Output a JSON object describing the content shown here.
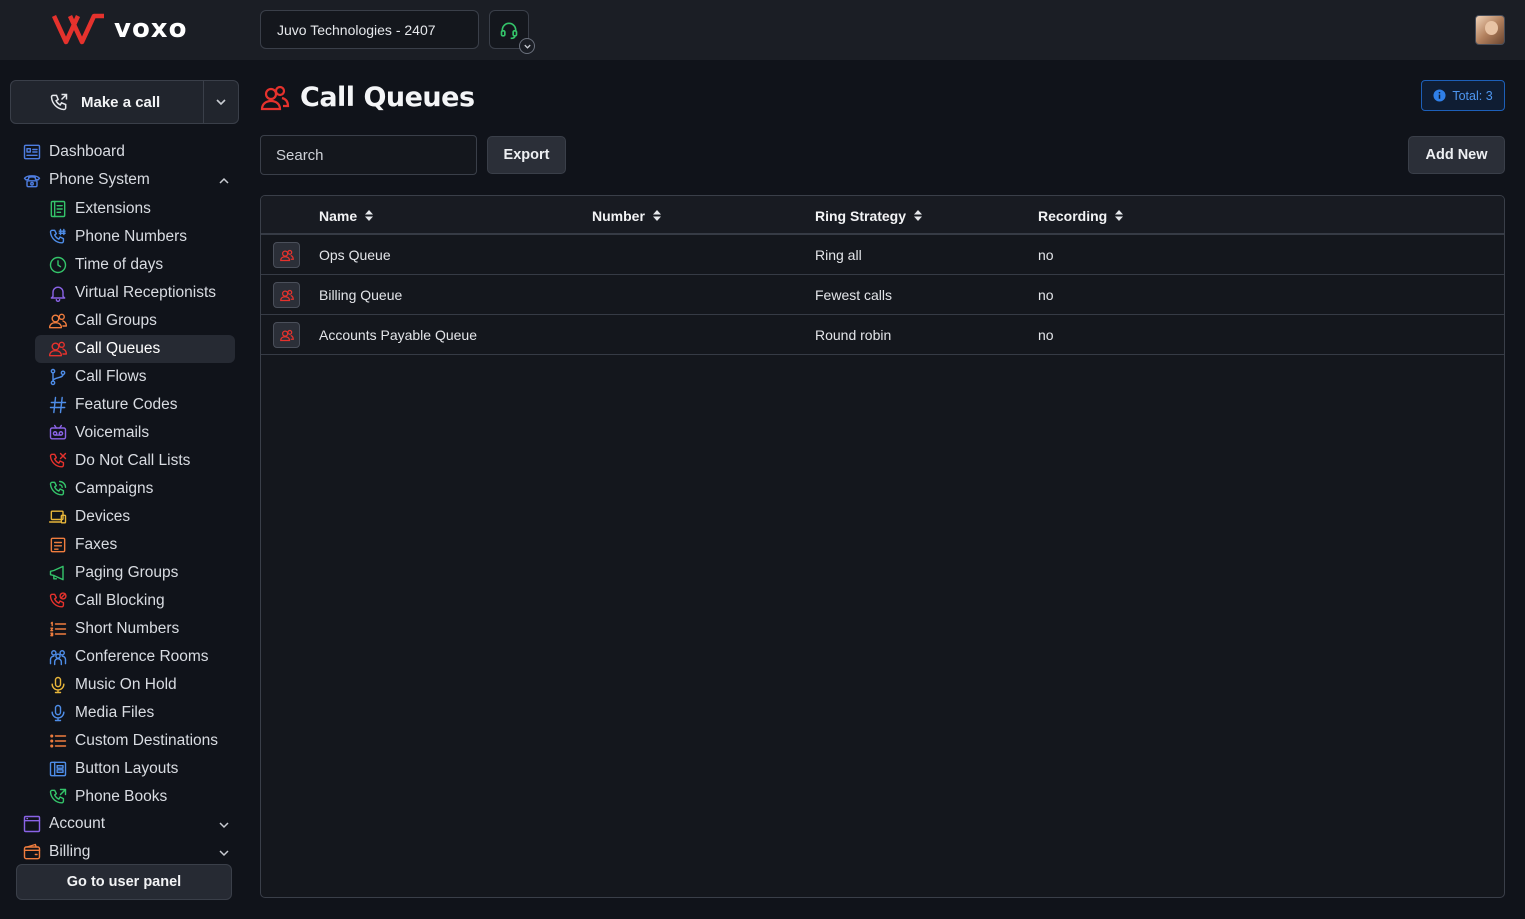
{
  "brand": {
    "name": "voxo",
    "accent": "#e5322d"
  },
  "header": {
    "tenant": "Juvo Technologies - 2407",
    "headset_icon": "headset-icon",
    "avatar": "user-avatar"
  },
  "sidebar": {
    "make_call": "Make a call",
    "items": [
      {
        "label": "Dashboard",
        "icon": "dashboard-icon",
        "color": "#4e7de0",
        "level": 0
      },
      {
        "label": "Phone System",
        "icon": "phone-system-icon",
        "color": "#4e7de0",
        "level": 0,
        "expanded": true
      },
      {
        "label": "Extensions",
        "icon": "extensions-icon",
        "color": "#34c46a",
        "level": 1
      },
      {
        "label": "Phone Numbers",
        "icon": "phone-numbers-icon",
        "color": "#4e8de8",
        "level": 1
      },
      {
        "label": "Time of days",
        "icon": "clock-icon",
        "color": "#34c46a",
        "level": 1
      },
      {
        "label": "Virtual Receptionists",
        "icon": "bell-icon",
        "color": "#8a63e6",
        "level": 1
      },
      {
        "label": "Call Groups",
        "icon": "call-groups-icon",
        "color": "#f07d3e",
        "level": 1
      },
      {
        "label": "Call Queues",
        "icon": "call-queues-icon",
        "color": "#e5322d",
        "level": 1,
        "active": true
      },
      {
        "label": "Call Flows",
        "icon": "branch-icon",
        "color": "#4e8de8",
        "level": 1
      },
      {
        "label": "Feature Codes",
        "icon": "hash-icon",
        "color": "#4e8de8",
        "level": 1
      },
      {
        "label": "Voicemails",
        "icon": "voicemail-icon",
        "color": "#8a63e6",
        "level": 1
      },
      {
        "label": "Do Not Call Lists",
        "icon": "do-not-call-icon",
        "color": "#e5322d",
        "level": 1
      },
      {
        "label": "Campaigns",
        "icon": "campaigns-icon",
        "color": "#34c46a",
        "level": 1
      },
      {
        "label": "Devices",
        "icon": "devices-icon",
        "color": "#e8b63a",
        "level": 1
      },
      {
        "label": "Faxes",
        "icon": "fax-icon",
        "color": "#f07d3e",
        "level": 1
      },
      {
        "label": "Paging Groups",
        "icon": "megaphone-icon",
        "color": "#34c46a",
        "level": 1
      },
      {
        "label": "Call Blocking",
        "icon": "call-blocking-icon",
        "color": "#e5322d",
        "level": 1
      },
      {
        "label": "Short Numbers",
        "icon": "numbered-list-icon",
        "color": "#f07d3e",
        "level": 1
      },
      {
        "label": "Conference Rooms",
        "icon": "conference-icon",
        "color": "#4e8de8",
        "level": 1
      },
      {
        "label": "Music On Hold",
        "icon": "microphone-icon",
        "color": "#e8b63a",
        "level": 1
      },
      {
        "label": "Media Files",
        "icon": "media-mic-icon",
        "color": "#4e8de8",
        "level": 1
      },
      {
        "label": "Custom Destinations",
        "icon": "list-icon",
        "color": "#f07d3e",
        "level": 1
      },
      {
        "label": "Button Layouts",
        "icon": "button-layouts-icon",
        "color": "#4e8de8",
        "level": 1
      },
      {
        "label": "Phone Books",
        "icon": "phone-books-icon",
        "color": "#34c46a",
        "level": 1
      },
      {
        "label": "Account",
        "icon": "account-icon",
        "color": "#8a63e6",
        "level": 0,
        "expanded": false
      },
      {
        "label": "Billing",
        "icon": "wallet-icon",
        "color": "#f07d3e",
        "level": 0,
        "expanded": false
      }
    ],
    "user_panel": "Go to user panel"
  },
  "main": {
    "title": "Call Queues",
    "total": "Total: 3",
    "search_placeholder": "Search",
    "export": "Export",
    "add_new": "Add New",
    "columns": [
      "Name",
      "Number",
      "Ring Strategy",
      "Recording"
    ],
    "rows": [
      {
        "name": "Ops Queue",
        "number": "",
        "ring_strategy": "Ring all",
        "recording": "no"
      },
      {
        "name": "Billing Queue",
        "number": "",
        "ring_strategy": "Fewest calls",
        "recording": "no"
      },
      {
        "name": "Accounts Payable Queue",
        "number": "",
        "ring_strategy": "Round robin",
        "recording": "no"
      }
    ]
  }
}
